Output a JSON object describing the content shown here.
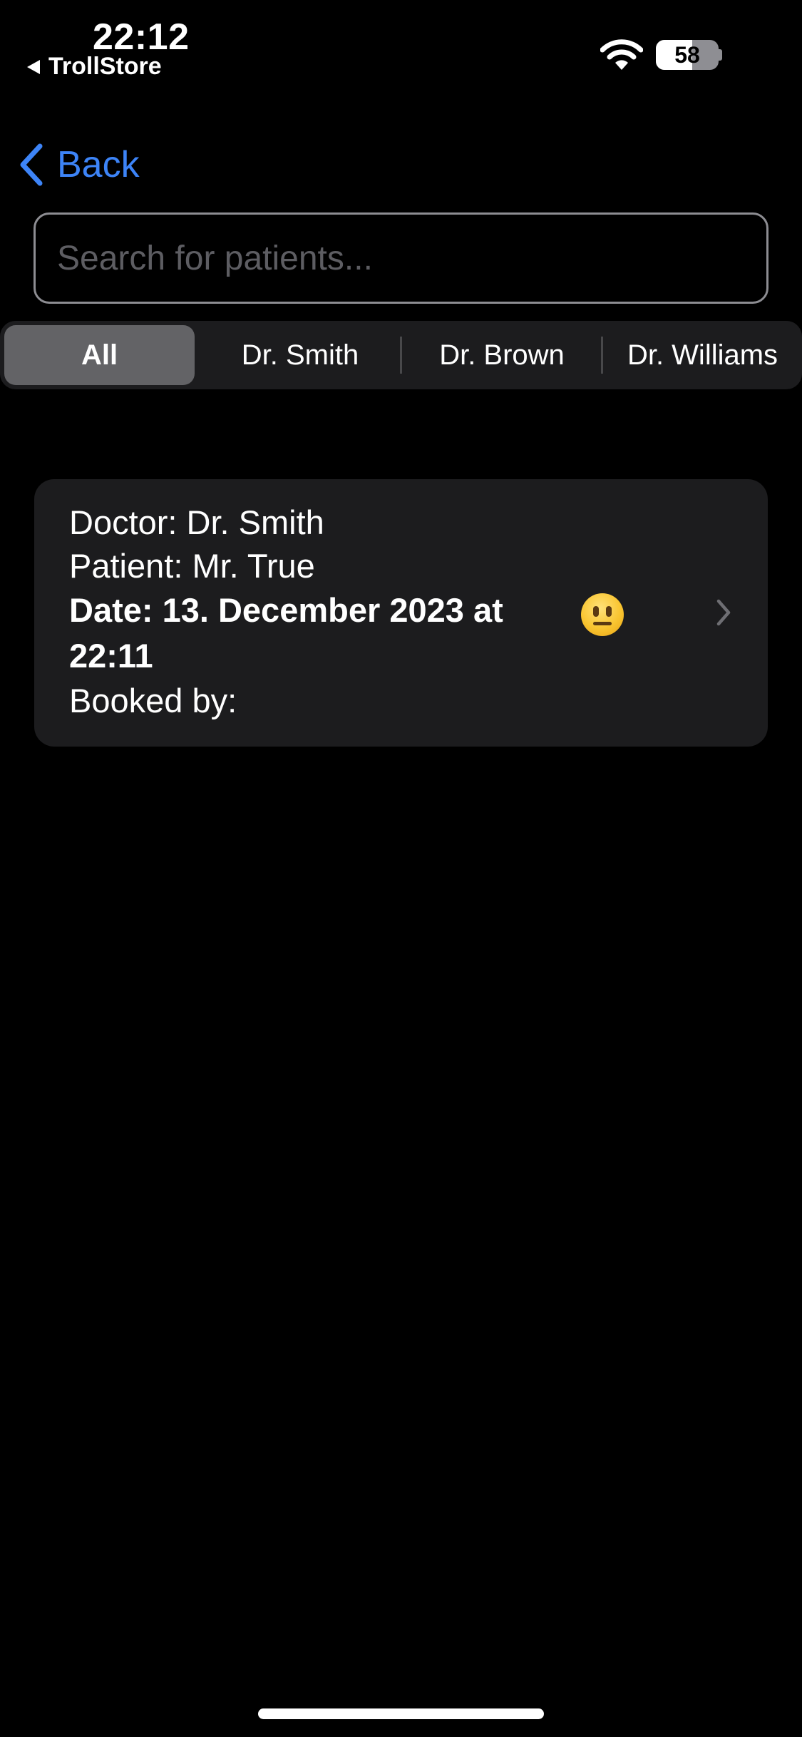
{
  "status_bar": {
    "time": "22:12",
    "back_app": "TrollStore",
    "battery_level": "58",
    "battery_fraction": 0.58,
    "icons": [
      "back-triangle-icon",
      "wifi-icon",
      "battery-icon"
    ]
  },
  "nav": {
    "back_label": "Back",
    "back_icon": "chevron-left-icon",
    "accent_color": "#3d84f7"
  },
  "search": {
    "placeholder": "Search for patients...",
    "value": ""
  },
  "filters": {
    "options": [
      "All",
      "Dr. Smith",
      "Dr. Brown",
      "Dr. Williams"
    ],
    "selected": "All"
  },
  "appointments": [
    {
      "doctor": "Doctor: Dr. Smith",
      "patient": "Patient: Mr. True",
      "date_line1": "Date: 13. December 2023 at",
      "date_line2": "22:11",
      "booked_by": "Booked by:",
      "status_icon": "neutral-face-emoji-icon",
      "disclosure_icon": "chevron-right-icon"
    }
  ]
}
